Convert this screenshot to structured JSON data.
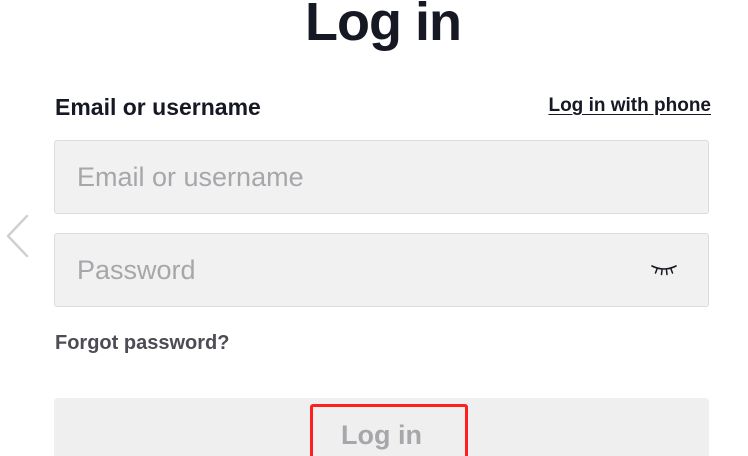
{
  "page": {
    "title": "Log in"
  },
  "form": {
    "email_label": "Email or username",
    "phone_link": "Log in with phone",
    "email_placeholder": "Email or username",
    "email_value": "",
    "password_placeholder": "Password",
    "password_value": "",
    "forgot_password": "Forgot password?",
    "submit_label": "Log in"
  },
  "icons": {
    "back": "chevron-left-icon",
    "password_toggle": "eye-closed-icon"
  },
  "colors": {
    "text": "#161823",
    "placeholder": "#a7a7ab",
    "input_bg": "#f1f1f2",
    "button_bg": "#efeff0",
    "highlight": "#ff1f1f"
  }
}
